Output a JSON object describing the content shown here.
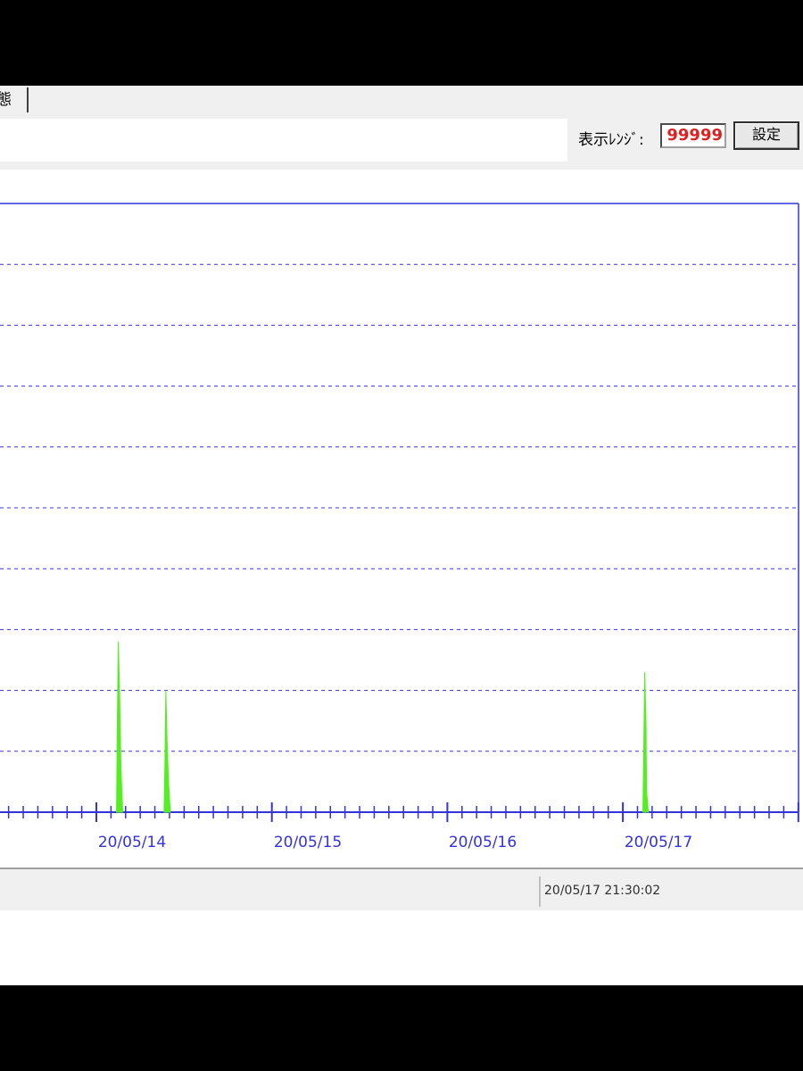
{
  "tabs": [
    {
      "label": "態"
    }
  ],
  "toolbar": {
    "range_label": "表示ﾚﾝｼﾞ:",
    "range_value": "99999",
    "set_button": "設定"
  },
  "status": {
    "timestamp": "20/05/17 21:30:02"
  },
  "colors": {
    "axis": "#3333dd",
    "grid": "#3333dd",
    "series": "#55ee22",
    "range_text": "#e02020"
  },
  "chart_data": {
    "type": "area",
    "title": "",
    "x_tick_labels": [
      "20/05/14",
      "20/05/15",
      "20/05/16",
      "20/05/17"
    ],
    "grid": "horizontal dashed",
    "series": [
      {
        "color": "#55ee22",
        "points": [
          {
            "x": "20/05/14 03:00",
            "y": 0.28
          },
          {
            "x": "20/05/14 03:30",
            "y": 0.07
          },
          {
            "x": "20/05/14 09:30",
            "y": 0.2
          },
          {
            "x": "20/05/14 09:45",
            "y": 0.05
          },
          {
            "x": "20/05/17 03:00",
            "y": 0.23
          }
        ]
      }
    ]
  }
}
